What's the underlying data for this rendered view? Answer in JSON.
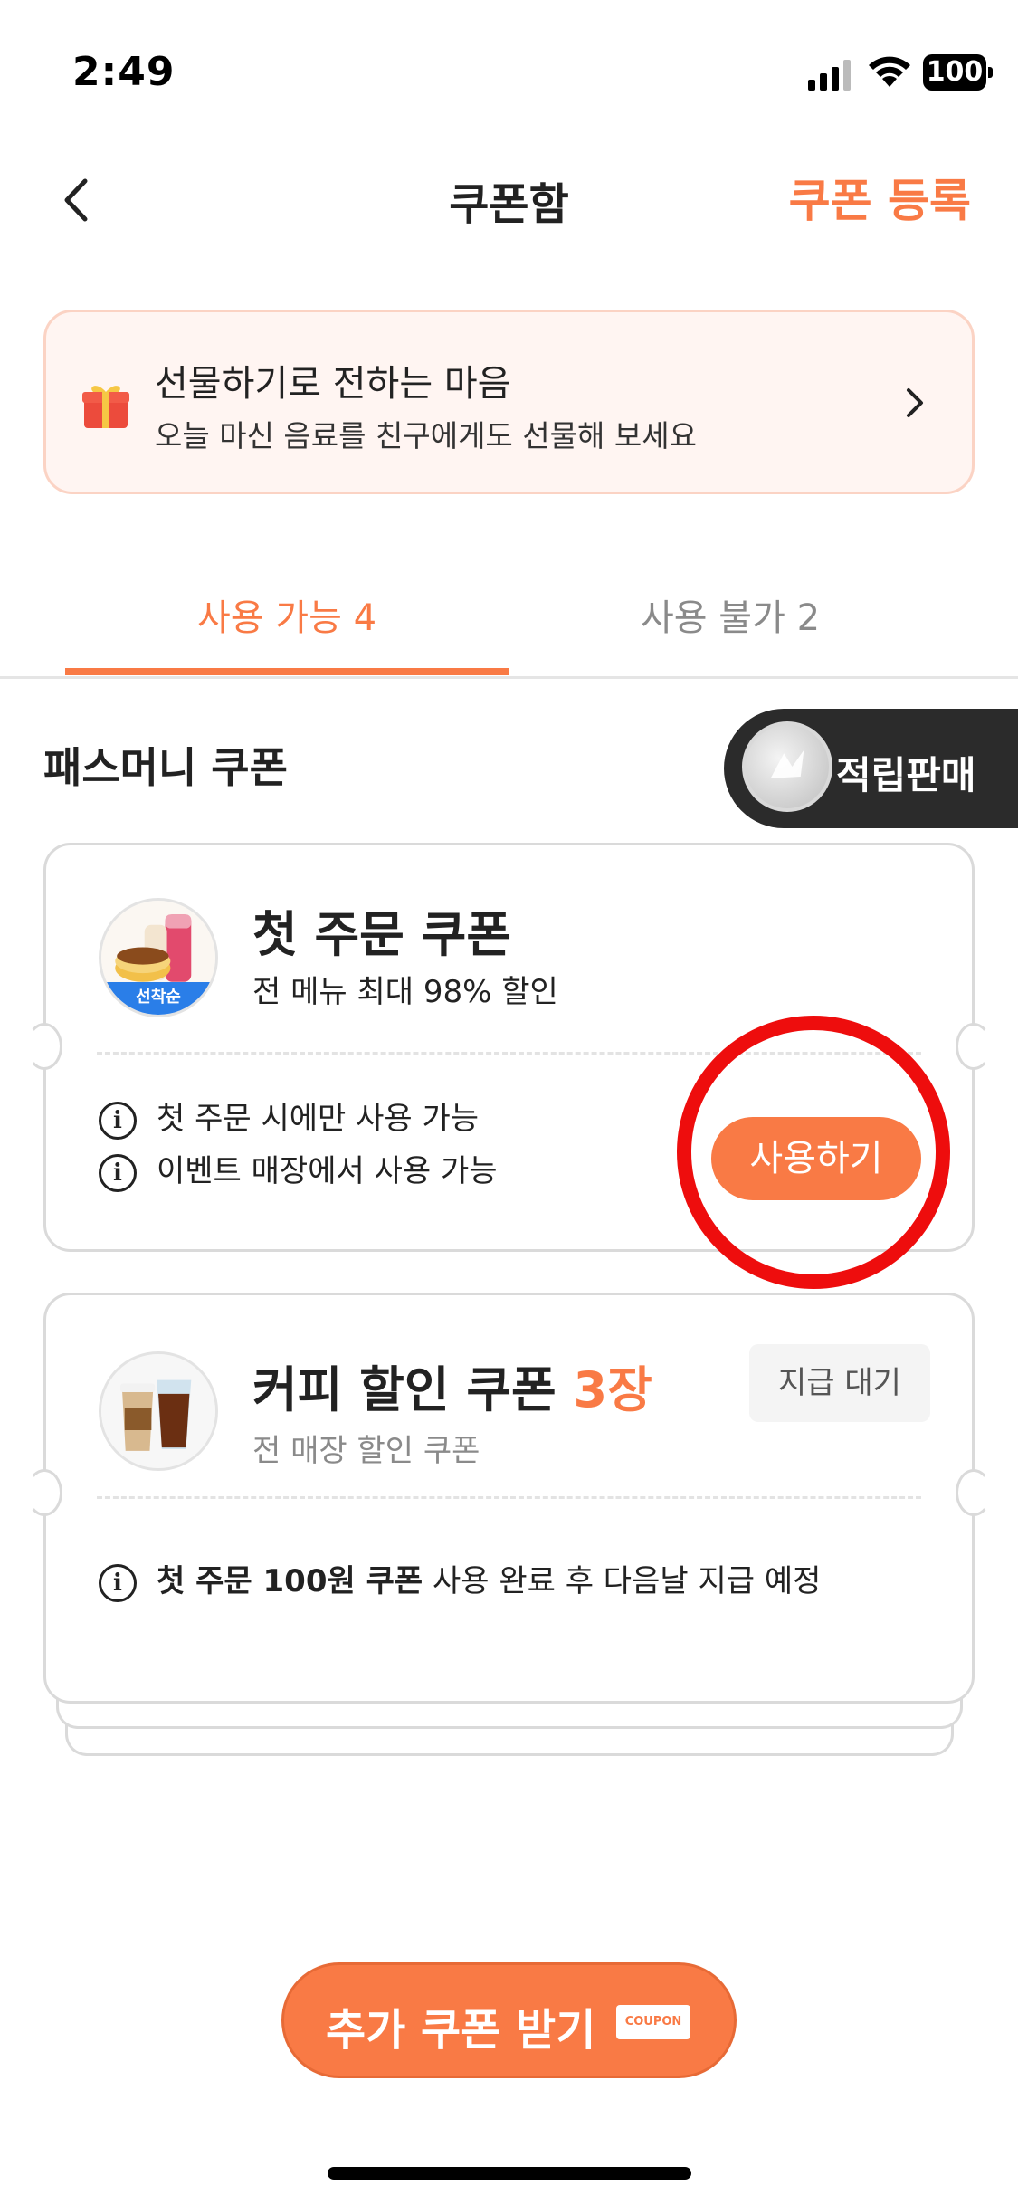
{
  "status_bar": {
    "time": "2:49",
    "battery": "100"
  },
  "nav": {
    "title": "쿠폰함",
    "register_label": "쿠폰 등록"
  },
  "gift_banner": {
    "title": "선물하기로 전하는 마음",
    "subtitle": "오늘 마신 음료를 친구에게도 선물해 보세요"
  },
  "tabs": [
    {
      "label": "사용 가능 4",
      "selected": true
    },
    {
      "label": "사용 불가 2",
      "selected": false
    }
  ],
  "section": {
    "title": "패스머니 쿠폰"
  },
  "point_button": {
    "label": "적립판매"
  },
  "coupons": [
    {
      "title": "첫 주문 쿠폰",
      "description": "전 메뉴 최대 98% 할인",
      "badge": "선착순",
      "notes": [
        "첫 주문 시에만 사용 가능",
        "이벤트 매장에서 사용 가능"
      ],
      "action_label": "사용하기"
    },
    {
      "title": "커피 할인 쿠폰",
      "count": "3장",
      "description": "전 매장 할인 쿠폰",
      "status": "지급 대기",
      "note_bold": "첫 주문 100원 쿠폰",
      "note_rest": " 사용 완료 후 다음날 지급 예정"
    }
  ],
  "bottom": {
    "more_label": "추가 쿠폰 받기",
    "ticket_text": "COUPON"
  },
  "colors": {
    "accent": "#f97a45",
    "highlight_circle": "#ee0d0d",
    "point_button_bg": "#2b2b2b"
  }
}
